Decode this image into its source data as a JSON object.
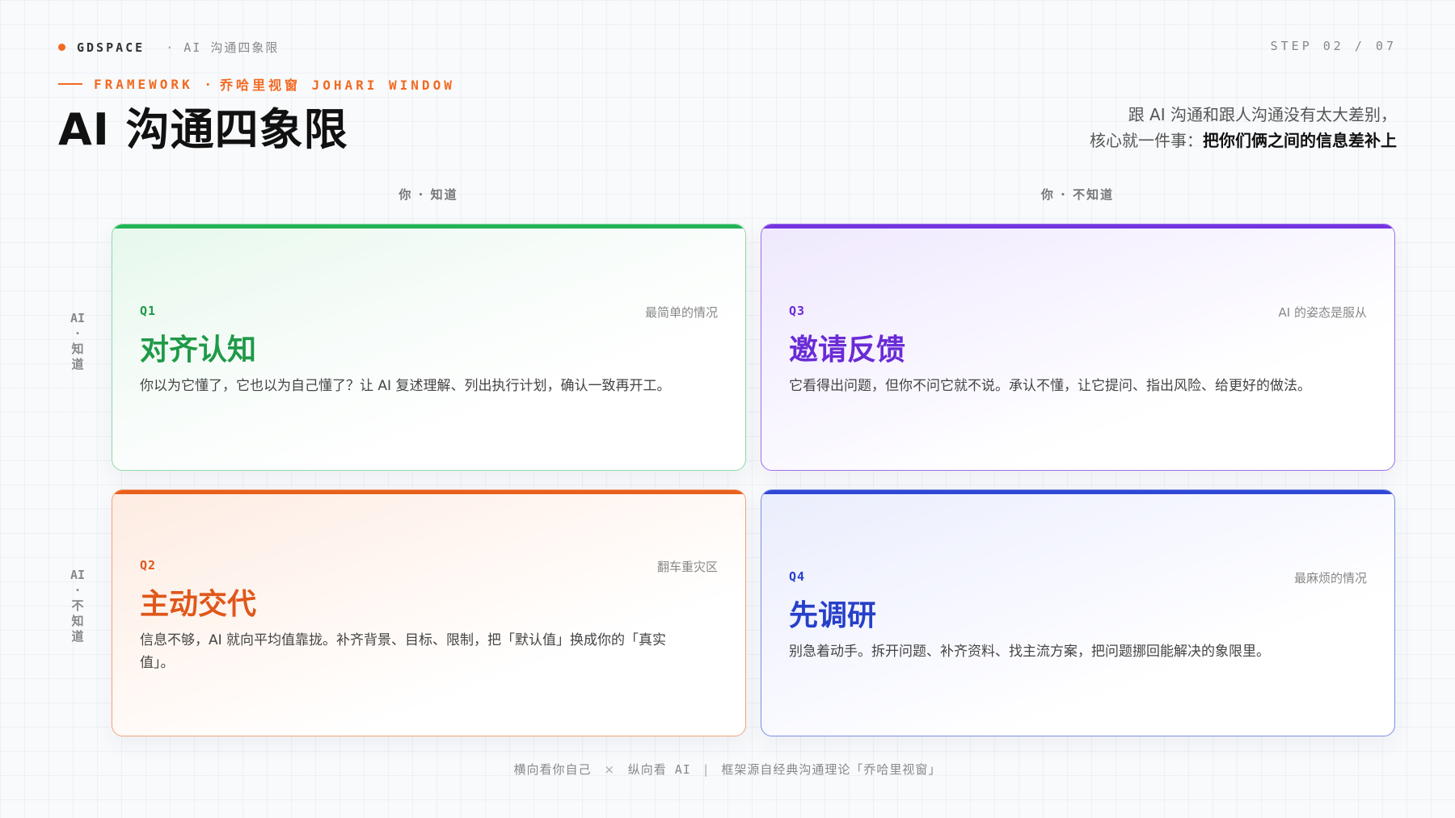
{
  "header": {
    "brand": "GDSPACE",
    "brand_sep": "·",
    "brand_sub": "AI 沟通四象限",
    "step": "STEP 02 / 07",
    "kicker_a": "FRAMEWORK ·",
    "kicker_b": "乔哈里视窗 JOHARI WINDOW",
    "title": "AI 沟通四象限",
    "tagline_line1": "跟 AI 沟通和跟人沟通没有太大差别，",
    "tagline_line2_prefix": "核心就一件事：",
    "tagline_line2_bold": "把你们俩之间的信息差补上"
  },
  "axes": {
    "col_known": "你 · 知道",
    "col_unknown": "你 · 不知道",
    "row_known": "AI·知道",
    "row_unknown": "AI·不知道"
  },
  "quadrants": [
    {
      "code": "Q1",
      "tag": "最简单的情况",
      "name": "对齐认知",
      "desc": "你以为它懂了，它也以为自己懂了？让 AI 复述理解、列出执行计划，确认一致再开工。",
      "accent": "#22b356"
    },
    {
      "code": "Q3",
      "tag": "AI 的姿态是服从",
      "name": "邀请反馈",
      "desc": "它看得出问题，但你不问它就不说。承认不懂，让它提问、指出风险、给更好的做法。",
      "accent": "#7434e0"
    },
    {
      "code": "Q2",
      "tag": "翻车重灾区",
      "name": "主动交代",
      "desc": "信息不够，AI 就向平均值靠拢。补齐背景、目标、限制，把「默认值」换成你的「真实值」。",
      "accent": "#e8601c"
    },
    {
      "code": "Q4",
      "tag": "最麻烦的情况",
      "name": "先调研",
      "desc": "别急着动手。拆开问题、补齐资料、找主流方案，把问题挪回能解决的象限里。",
      "accent": "#2f48d6"
    }
  ],
  "footer": {
    "part1": "横向看你自己",
    "times": "×",
    "part2": "纵向看 AI",
    "bar": "|",
    "part3": "框架源自经典沟通理论「乔哈里视窗」"
  }
}
